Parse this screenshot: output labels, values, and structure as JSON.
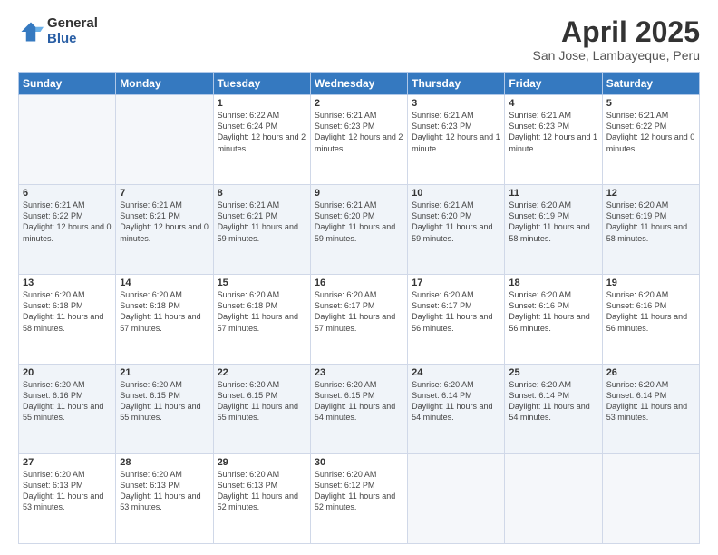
{
  "logo": {
    "general": "General",
    "blue": "Blue"
  },
  "header": {
    "title": "April 2025",
    "subtitle": "San Jose, Lambayeque, Peru"
  },
  "days_of_week": [
    "Sunday",
    "Monday",
    "Tuesday",
    "Wednesday",
    "Thursday",
    "Friday",
    "Saturday"
  ],
  "weeks": [
    [
      {
        "day": "",
        "info": ""
      },
      {
        "day": "",
        "info": ""
      },
      {
        "day": "1",
        "info": "Sunrise: 6:22 AM\nSunset: 6:24 PM\nDaylight: 12 hours and 2 minutes."
      },
      {
        "day": "2",
        "info": "Sunrise: 6:21 AM\nSunset: 6:23 PM\nDaylight: 12 hours and 2 minutes."
      },
      {
        "day": "3",
        "info": "Sunrise: 6:21 AM\nSunset: 6:23 PM\nDaylight: 12 hours and 1 minute."
      },
      {
        "day": "4",
        "info": "Sunrise: 6:21 AM\nSunset: 6:23 PM\nDaylight: 12 hours and 1 minute."
      },
      {
        "day": "5",
        "info": "Sunrise: 6:21 AM\nSunset: 6:22 PM\nDaylight: 12 hours and 0 minutes."
      }
    ],
    [
      {
        "day": "6",
        "info": "Sunrise: 6:21 AM\nSunset: 6:22 PM\nDaylight: 12 hours and 0 minutes."
      },
      {
        "day": "7",
        "info": "Sunrise: 6:21 AM\nSunset: 6:21 PM\nDaylight: 12 hours and 0 minutes."
      },
      {
        "day": "8",
        "info": "Sunrise: 6:21 AM\nSunset: 6:21 PM\nDaylight: 11 hours and 59 minutes."
      },
      {
        "day": "9",
        "info": "Sunrise: 6:21 AM\nSunset: 6:20 PM\nDaylight: 11 hours and 59 minutes."
      },
      {
        "day": "10",
        "info": "Sunrise: 6:21 AM\nSunset: 6:20 PM\nDaylight: 11 hours and 59 minutes."
      },
      {
        "day": "11",
        "info": "Sunrise: 6:20 AM\nSunset: 6:19 PM\nDaylight: 11 hours and 58 minutes."
      },
      {
        "day": "12",
        "info": "Sunrise: 6:20 AM\nSunset: 6:19 PM\nDaylight: 11 hours and 58 minutes."
      }
    ],
    [
      {
        "day": "13",
        "info": "Sunrise: 6:20 AM\nSunset: 6:18 PM\nDaylight: 11 hours and 58 minutes."
      },
      {
        "day": "14",
        "info": "Sunrise: 6:20 AM\nSunset: 6:18 PM\nDaylight: 11 hours and 57 minutes."
      },
      {
        "day": "15",
        "info": "Sunrise: 6:20 AM\nSunset: 6:18 PM\nDaylight: 11 hours and 57 minutes."
      },
      {
        "day": "16",
        "info": "Sunrise: 6:20 AM\nSunset: 6:17 PM\nDaylight: 11 hours and 57 minutes."
      },
      {
        "day": "17",
        "info": "Sunrise: 6:20 AM\nSunset: 6:17 PM\nDaylight: 11 hours and 56 minutes."
      },
      {
        "day": "18",
        "info": "Sunrise: 6:20 AM\nSunset: 6:16 PM\nDaylight: 11 hours and 56 minutes."
      },
      {
        "day": "19",
        "info": "Sunrise: 6:20 AM\nSunset: 6:16 PM\nDaylight: 11 hours and 56 minutes."
      }
    ],
    [
      {
        "day": "20",
        "info": "Sunrise: 6:20 AM\nSunset: 6:16 PM\nDaylight: 11 hours and 55 minutes."
      },
      {
        "day": "21",
        "info": "Sunrise: 6:20 AM\nSunset: 6:15 PM\nDaylight: 11 hours and 55 minutes."
      },
      {
        "day": "22",
        "info": "Sunrise: 6:20 AM\nSunset: 6:15 PM\nDaylight: 11 hours and 55 minutes."
      },
      {
        "day": "23",
        "info": "Sunrise: 6:20 AM\nSunset: 6:15 PM\nDaylight: 11 hours and 54 minutes."
      },
      {
        "day": "24",
        "info": "Sunrise: 6:20 AM\nSunset: 6:14 PM\nDaylight: 11 hours and 54 minutes."
      },
      {
        "day": "25",
        "info": "Sunrise: 6:20 AM\nSunset: 6:14 PM\nDaylight: 11 hours and 54 minutes."
      },
      {
        "day": "26",
        "info": "Sunrise: 6:20 AM\nSunset: 6:14 PM\nDaylight: 11 hours and 53 minutes."
      }
    ],
    [
      {
        "day": "27",
        "info": "Sunrise: 6:20 AM\nSunset: 6:13 PM\nDaylight: 11 hours and 53 minutes."
      },
      {
        "day": "28",
        "info": "Sunrise: 6:20 AM\nSunset: 6:13 PM\nDaylight: 11 hours and 53 minutes."
      },
      {
        "day": "29",
        "info": "Sunrise: 6:20 AM\nSunset: 6:13 PM\nDaylight: 11 hours and 52 minutes."
      },
      {
        "day": "30",
        "info": "Sunrise: 6:20 AM\nSunset: 6:12 PM\nDaylight: 11 hours and 52 minutes."
      },
      {
        "day": "",
        "info": ""
      },
      {
        "day": "",
        "info": ""
      },
      {
        "day": "",
        "info": ""
      }
    ]
  ]
}
